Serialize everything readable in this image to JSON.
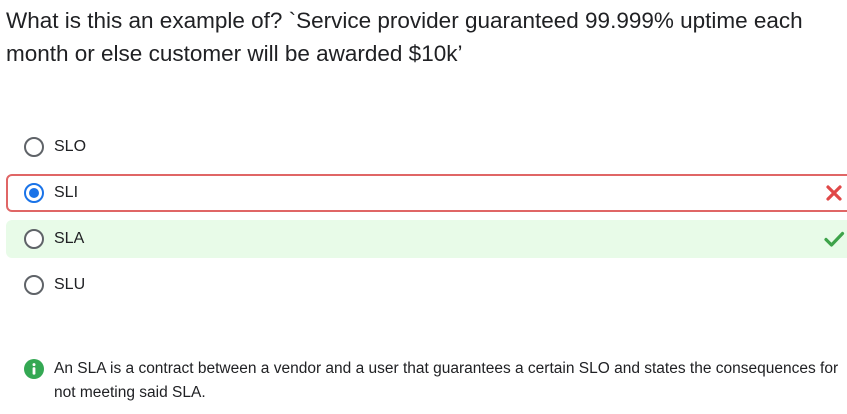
{
  "question": {
    "text": "What is this an example of? `Service provider guaranteed 99.999% uptime each month or else customer will be awarded $10k’"
  },
  "options": [
    {
      "label": "SLO",
      "state": "default"
    },
    {
      "label": "SLI",
      "state": "selected-wrong"
    },
    {
      "label": "SLA",
      "state": "correct"
    },
    {
      "label": "SLU",
      "state": "default"
    }
  ],
  "feedback": {
    "text": "An SLA is a contract between a vendor and a user that guarantees a certain SLO and states the consequences for not meeting said SLA."
  },
  "colors": {
    "wrong_border": "#e06666",
    "wrong_mark": "#e04848",
    "correct_bg": "#e8fbe8",
    "correct_mark": "#3ea34a",
    "selected_radio": "#1a73e8",
    "info_icon": "#34a853"
  },
  "icons": {
    "wrong": "x-mark-icon",
    "correct": "check-mark-icon",
    "feedback": "info-icon"
  }
}
